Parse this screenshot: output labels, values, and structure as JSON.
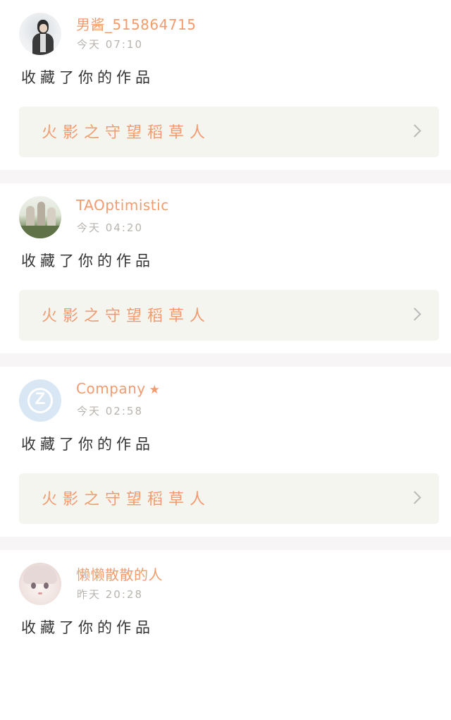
{
  "notifications": [
    {
      "user_name": "男酱_515864715",
      "verified": false,
      "time": "今天 07:10",
      "action": "收藏了你的作品",
      "work_title": "火影之守望稻草人",
      "avatar": "avatar-man-dark-hair"
    },
    {
      "user_name": "TAOptimistic",
      "verified": false,
      "time": "今天 04:20",
      "action": "收藏了你的作品",
      "work_title": "火影之守望稻草人",
      "avatar": "avatar-group-photo"
    },
    {
      "user_name": "Company",
      "verified": true,
      "time": "今天 02:58",
      "action": "收藏了你的作品",
      "work_title": "火影之守望稻草人",
      "avatar": "avatar-default-z-logo"
    },
    {
      "user_name": "懒懒散散的人",
      "verified": false,
      "time": "昨天 20:28",
      "action": "收藏了你的作品",
      "work_title": "",
      "avatar": "avatar-anime-girl"
    }
  ],
  "icons": {
    "verified": "star-icon",
    "chevron": "chevron-right-icon"
  },
  "colors": {
    "accent": "#f39b6e",
    "muted_text": "#b8b3ae",
    "body_text": "#333333",
    "work_box_bg": "#f5f5ef",
    "separator": "#f7f5f5"
  }
}
